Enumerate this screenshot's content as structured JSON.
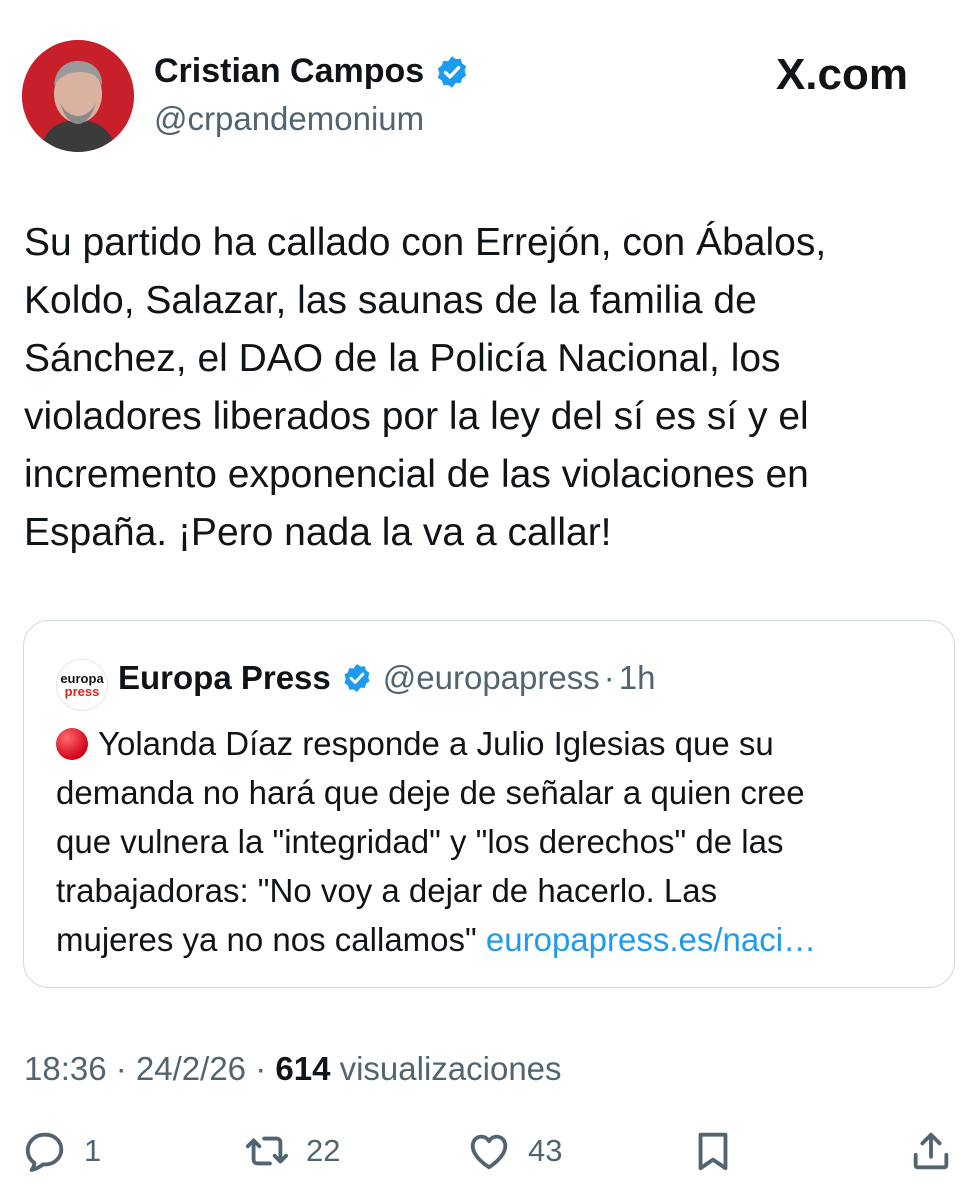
{
  "author": {
    "name": "Cristian Campos",
    "handle": "@crpandemonium"
  },
  "brand": "X.com",
  "tweet": {
    "lines": [
      "Su partido ha callado con Errejón, con Ábalos,",
      "Koldo, Salazar, las saunas de la familia de",
      "Sánchez, el DAO de la Policía Nacional, los",
      "violadores liberados por la ley del sí es sí y el",
      "incremento exponencial de las violaciones en",
      "España. ¡Pero nada la va a callar!"
    ]
  },
  "quote": {
    "logo_top": "europa",
    "logo_bottom": "press",
    "name": "Europa Press",
    "handle": "@europapress",
    "separator": "·",
    "time": "1h",
    "lines": [
      "Yolanda Díaz responde a Julio Iglesias que su",
      "demanda no hará que deje de señalar a quien cree",
      "que vulnera la \"integridad\" y \"los derechos\" de las",
      "trabajadoras: \"No voy a dejar de hacerlo. Las",
      "mujeres ya no nos callamos\""
    ],
    "link": "europapress.es/naci…"
  },
  "meta": {
    "time": "18:36",
    "sep1": " · ",
    "date": "24/2/26",
    "sep2": " · ",
    "views_count": "614",
    "views_label": " visualizaciones"
  },
  "actions": {
    "replies": "1",
    "reposts": "22",
    "likes": "43"
  },
  "icons": {
    "verified": "verified-badge-icon",
    "reply": "reply-icon",
    "repost": "repost-icon",
    "like": "heart-icon",
    "bookmark": "bookmark-icon",
    "share": "share-icon"
  },
  "colors": {
    "accent": "#1d9bf0",
    "avatar_bg": "#c8202a",
    "secondary_text": "#536471"
  }
}
